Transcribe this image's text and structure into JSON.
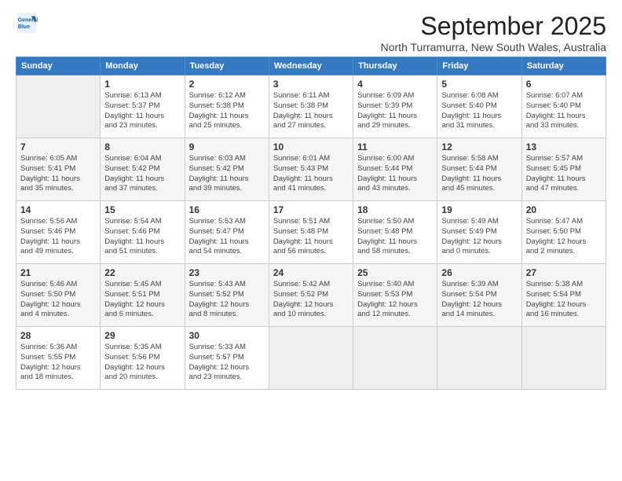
{
  "logo": {
    "line1": "General",
    "line2": "Blue"
  },
  "title": "September 2025",
  "subtitle": "North Turramurra, New South Wales, Australia",
  "days_header": [
    "Sunday",
    "Monday",
    "Tuesday",
    "Wednesday",
    "Thursday",
    "Friday",
    "Saturday"
  ],
  "weeks": [
    [
      {
        "day": "",
        "info": ""
      },
      {
        "day": "1",
        "info": "Sunrise: 6:13 AM\nSunset: 5:37 PM\nDaylight: 11 hours\nand 23 minutes."
      },
      {
        "day": "2",
        "info": "Sunrise: 6:12 AM\nSunset: 5:38 PM\nDaylight: 11 hours\nand 25 minutes."
      },
      {
        "day": "3",
        "info": "Sunrise: 6:11 AM\nSunset: 5:38 PM\nDaylight: 11 hours\nand 27 minutes."
      },
      {
        "day": "4",
        "info": "Sunrise: 6:09 AM\nSunset: 5:39 PM\nDaylight: 11 hours\nand 29 minutes."
      },
      {
        "day": "5",
        "info": "Sunrise: 6:08 AM\nSunset: 5:40 PM\nDaylight: 11 hours\nand 31 minutes."
      },
      {
        "day": "6",
        "info": "Sunrise: 6:07 AM\nSunset: 5:40 PM\nDaylight: 11 hours\nand 33 minutes."
      }
    ],
    [
      {
        "day": "7",
        "info": "Sunrise: 6:05 AM\nSunset: 5:41 PM\nDaylight: 11 hours\nand 35 minutes."
      },
      {
        "day": "8",
        "info": "Sunrise: 6:04 AM\nSunset: 5:42 PM\nDaylight: 11 hours\nand 37 minutes."
      },
      {
        "day": "9",
        "info": "Sunrise: 6:03 AM\nSunset: 5:42 PM\nDaylight: 11 hours\nand 39 minutes."
      },
      {
        "day": "10",
        "info": "Sunrise: 6:01 AM\nSunset: 5:43 PM\nDaylight: 11 hours\nand 41 minutes."
      },
      {
        "day": "11",
        "info": "Sunrise: 6:00 AM\nSunset: 5:44 PM\nDaylight: 11 hours\nand 43 minutes."
      },
      {
        "day": "12",
        "info": "Sunrise: 5:58 AM\nSunset: 5:44 PM\nDaylight: 11 hours\nand 45 minutes."
      },
      {
        "day": "13",
        "info": "Sunrise: 5:57 AM\nSunset: 5:45 PM\nDaylight: 11 hours\nand 47 minutes."
      }
    ],
    [
      {
        "day": "14",
        "info": "Sunrise: 5:56 AM\nSunset: 5:46 PM\nDaylight: 11 hours\nand 49 minutes."
      },
      {
        "day": "15",
        "info": "Sunrise: 5:54 AM\nSunset: 5:46 PM\nDaylight: 11 hours\nand 51 minutes."
      },
      {
        "day": "16",
        "info": "Sunrise: 5:53 AM\nSunset: 5:47 PM\nDaylight: 11 hours\nand 54 minutes."
      },
      {
        "day": "17",
        "info": "Sunrise: 5:51 AM\nSunset: 5:48 PM\nDaylight: 11 hours\nand 56 minutes."
      },
      {
        "day": "18",
        "info": "Sunrise: 5:50 AM\nSunset: 5:48 PM\nDaylight: 11 hours\nand 58 minutes."
      },
      {
        "day": "19",
        "info": "Sunrise: 5:49 AM\nSunset: 5:49 PM\nDaylight: 12 hours\nand 0 minutes."
      },
      {
        "day": "20",
        "info": "Sunrise: 5:47 AM\nSunset: 5:50 PM\nDaylight: 12 hours\nand 2 minutes."
      }
    ],
    [
      {
        "day": "21",
        "info": "Sunrise: 5:46 AM\nSunset: 5:50 PM\nDaylight: 12 hours\nand 4 minutes."
      },
      {
        "day": "22",
        "info": "Sunrise: 5:45 AM\nSunset: 5:51 PM\nDaylight: 12 hours\nand 6 minutes."
      },
      {
        "day": "23",
        "info": "Sunrise: 5:43 AM\nSunset: 5:52 PM\nDaylight: 12 hours\nand 8 minutes."
      },
      {
        "day": "24",
        "info": "Sunrise: 5:42 AM\nSunset: 5:52 PM\nDaylight: 12 hours\nand 10 minutes."
      },
      {
        "day": "25",
        "info": "Sunrise: 5:40 AM\nSunset: 5:53 PM\nDaylight: 12 hours\nand 12 minutes."
      },
      {
        "day": "26",
        "info": "Sunrise: 5:39 AM\nSunset: 5:54 PM\nDaylight: 12 hours\nand 14 minutes."
      },
      {
        "day": "27",
        "info": "Sunrise: 5:38 AM\nSunset: 5:54 PM\nDaylight: 12 hours\nand 16 minutes."
      }
    ],
    [
      {
        "day": "28",
        "info": "Sunrise: 5:36 AM\nSunset: 5:55 PM\nDaylight: 12 hours\nand 18 minutes."
      },
      {
        "day": "29",
        "info": "Sunrise: 5:35 AM\nSunset: 5:56 PM\nDaylight: 12 hours\nand 20 minutes."
      },
      {
        "day": "30",
        "info": "Sunrise: 5:33 AM\nSunset: 5:57 PM\nDaylight: 12 hours\nand 23 minutes."
      },
      {
        "day": "",
        "info": ""
      },
      {
        "day": "",
        "info": ""
      },
      {
        "day": "",
        "info": ""
      },
      {
        "day": "",
        "info": ""
      }
    ]
  ]
}
